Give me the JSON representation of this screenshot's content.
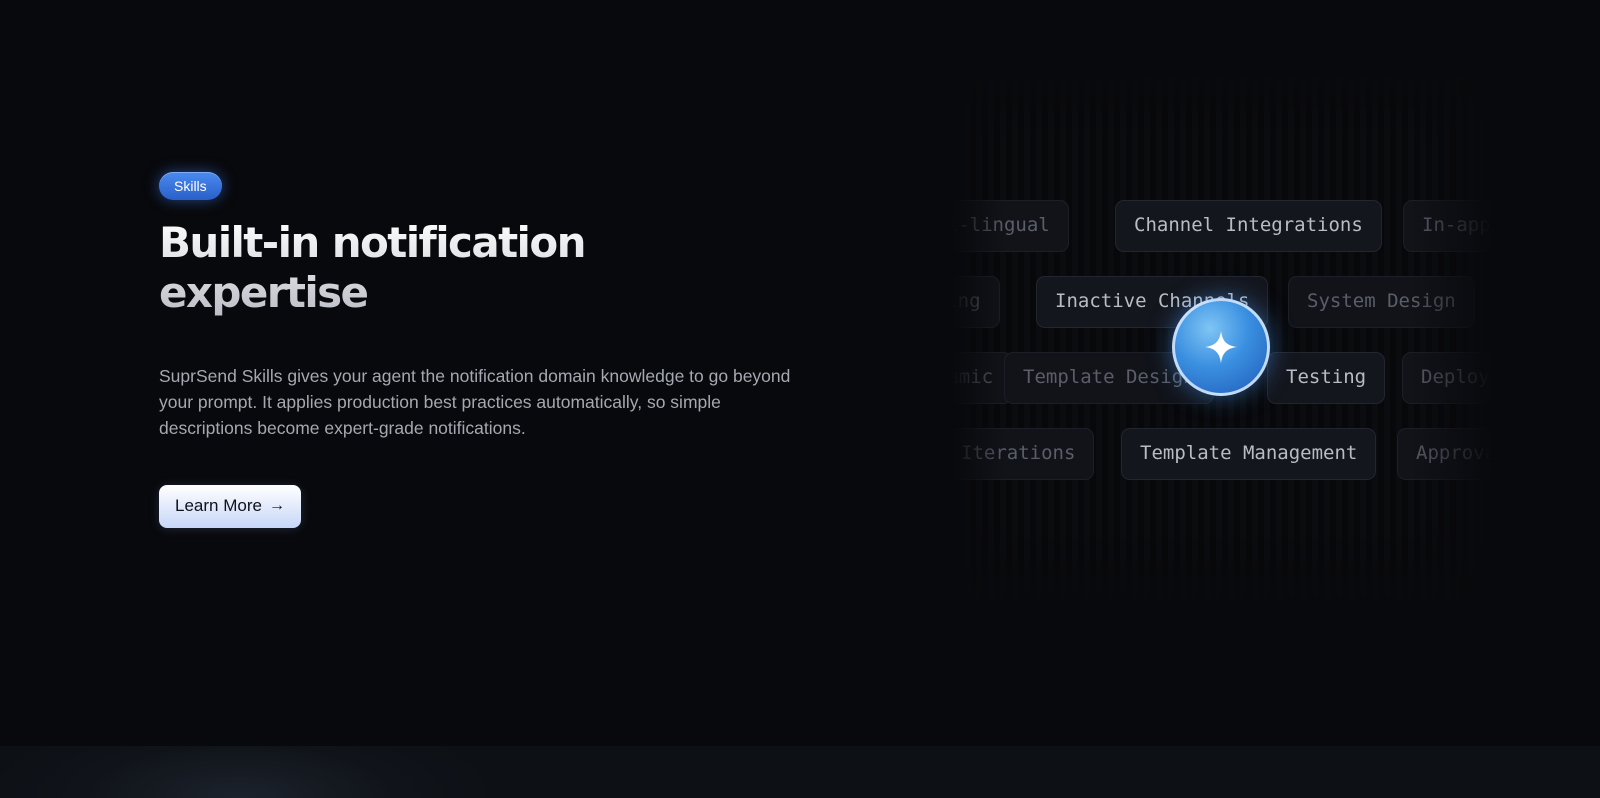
{
  "section": {
    "badge": "Skills",
    "title": "Built-in notification expertise",
    "description": "SuprSend Skills gives your agent the notification domain knowledge to go beyond your prompt. It applies production best practices automatically, so simple descriptions become expert-grade notifications.",
    "cta_label": "Learn More",
    "cta_icon": "arrow-right-icon"
  },
  "skills_panel": {
    "chips": [
      "Multi-lingual",
      "Channel Integrations",
      "In-app",
      "Batching",
      "Inactive Channels",
      "System Design",
      "Dynamic",
      "Template Design",
      "Testing",
      "Deploy",
      "Iterations",
      "Template Management",
      "Approval"
    ],
    "center_icon": "sparkle-icon",
    "accent_color": "#3a8fe0"
  }
}
